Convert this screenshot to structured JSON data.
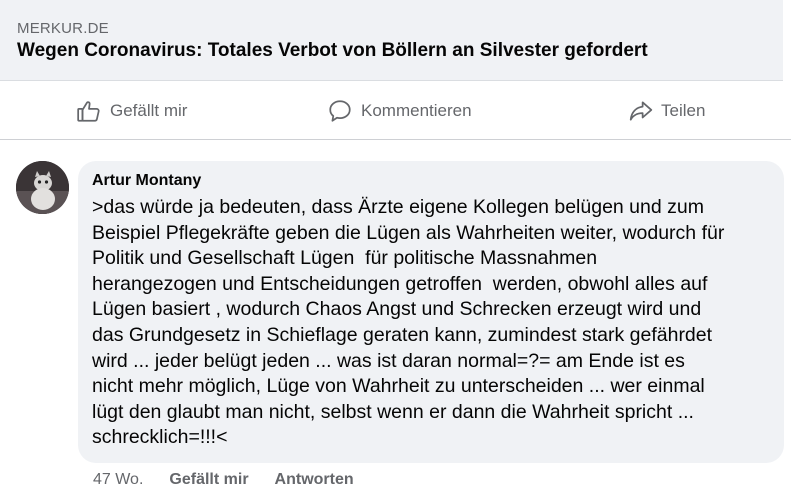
{
  "link_preview": {
    "source": "MERKUR.DE",
    "title": "Wegen Coronavirus: Totales Verbot von Böllern an Silvester gefordert"
  },
  "actions": {
    "like_label": "Gefällt mir",
    "comment_label": "Kommentieren",
    "share_label": "Teilen"
  },
  "comment": {
    "author": "Artur Montany",
    "lines": [
      ">das würde ja bedeuten, dass Ärzte eigene Kollegen belügen und zum",
      "Beispiel Pflegekräfte geben die Lügen als Wahrheiten weiter, wodurch für",
      "Politik und Gesellschaft Lügen  für politische Massnahmen",
      "herangezogen und Entscheidungen getroffen  werden, obwohl alles auf",
      "Lügen basiert , wodurch Chaos Angst und Schrecken erzeugt wird und",
      "das Grundgesetz in Schieflage geraten kann, zumindest stark gefährdet",
      "wird ... jeder belügt jeden ... was ist daran normal=?= am Ende ist es",
      "nicht mehr möglich, Lüge von Wahrheit zu unterscheiden ... wer einmal",
      "lügt den glaubt man nicht, selbst wenn er dann die Wahrheit spricht ...",
      "schrecklich=!!!<"
    ],
    "time": "47 Wo.",
    "like_label": "Gefällt mir",
    "reply_label": "Antworten"
  },
  "colors": {
    "secondary_text": "#65676b",
    "primary_text": "#050505",
    "bubble_bg": "#f0f2f5"
  },
  "icons": {
    "like": "thumbs-up-icon",
    "comment": "speech-bubble-icon",
    "share": "share-arrow-icon"
  }
}
